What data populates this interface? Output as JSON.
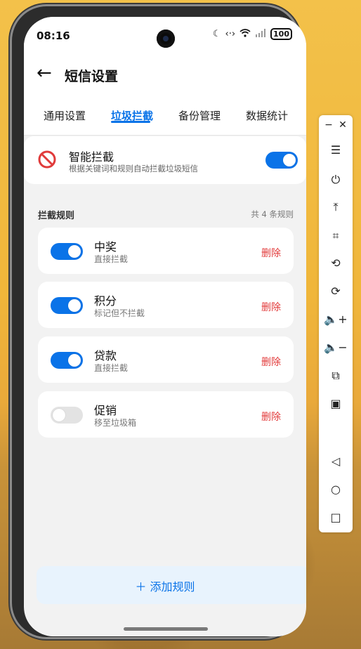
{
  "status": {
    "time": "08:16",
    "battery": "100"
  },
  "header": {
    "back_icon": "arrow-left-icon",
    "title": "短信设置"
  },
  "tabs": [
    {
      "label": "通用设置",
      "active": false
    },
    {
      "label": "垃圾拦截",
      "active": true
    },
    {
      "label": "备份管理",
      "active": false
    },
    {
      "label": "数据统计",
      "active": false
    }
  ],
  "smart_block": {
    "title": "智能拦截",
    "description": "根据关键词和规则自动拦截垃圾短信",
    "enabled": true
  },
  "rules_section": {
    "title": "拦截规则",
    "count_text": "共 4 条规则"
  },
  "rules": [
    {
      "name": "中奖",
      "action": "直接拦截",
      "enabled": true,
      "delete_label": "删除"
    },
    {
      "name": "积分",
      "action": "标记但不拦截",
      "enabled": true,
      "delete_label": "删除"
    },
    {
      "name": "贷款",
      "action": "直接拦截",
      "enabled": true,
      "delete_label": "删除"
    },
    {
      "name": "促销",
      "action": "移至垃圾箱",
      "enabled": false,
      "delete_label": "删除"
    }
  ],
  "add_button": {
    "label": "＋  添加规则"
  },
  "colors": {
    "accent": "#0a73e8",
    "danger": "#e23b3b",
    "toggle_off": "#e3e3e3"
  }
}
